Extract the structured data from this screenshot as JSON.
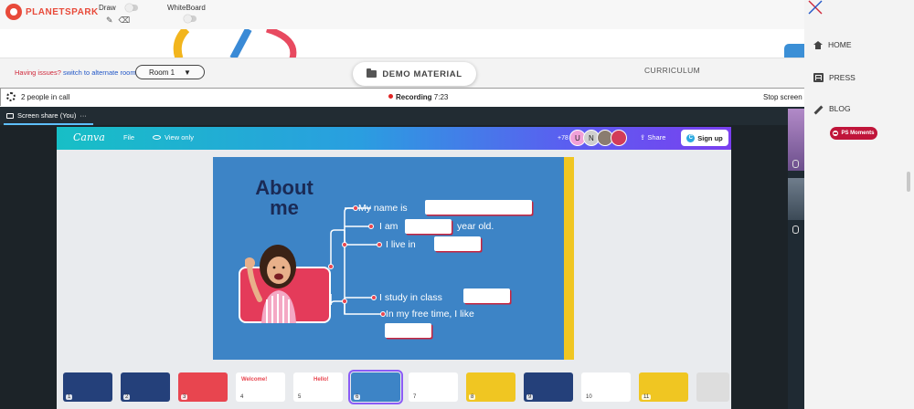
{
  "toolbar": {
    "logo_text": "PLANETSPARK",
    "draw_label": "Draw",
    "whiteboard_label": "WhiteBoard"
  },
  "roombar": {
    "issues_text": "Having issues?",
    "alternate_link": "switch to alternate room",
    "room_value": "Room 1",
    "room_caret": "▼",
    "demo_material": "DEMO MATERIAL",
    "curriculum": "CURRICULUM"
  },
  "callbar": {
    "people": "2 people in call",
    "recording_label": "Recording",
    "recording_time": "7:23",
    "stop_screen": "Stop screen"
  },
  "sharebar": {
    "label": "Screen share (You)",
    "more": "···"
  },
  "canva": {
    "logo": "Canva",
    "file": "File",
    "view_only": "View only",
    "collab_count": "+78",
    "avatar_u": "U",
    "avatar_n": "N",
    "share": "Share",
    "sign_up": "Sign up",
    "signup_glyph": "C"
  },
  "slide": {
    "title_line1": "About",
    "title_line2": "me",
    "my_name": "My name is",
    "i_am": "I am",
    "year_old": "year old.",
    "live_in": "I live in",
    "study_in": "I study in class",
    "free_time": "In my free time, I like"
  },
  "thumbnails": {
    "items": [
      {
        "num": "1",
        "word": "",
        "bg": "#24407a"
      },
      {
        "num": "2",
        "word": "",
        "bg": "#24407a"
      },
      {
        "num": "3",
        "word": "",
        "bg": "#e8454f"
      },
      {
        "num": "4",
        "word": "Welcome!",
        "bg": "#ffffff"
      },
      {
        "num": "5",
        "word": "Hello!",
        "bg": "#ffffff"
      },
      {
        "num": "6",
        "word": "",
        "bg": "#3d84c6"
      },
      {
        "num": "7",
        "word": "",
        "bg": "#ffffff"
      },
      {
        "num": "8",
        "word": "",
        "bg": "#f0c622"
      },
      {
        "num": "9",
        "word": "",
        "bg": "#24407a"
      },
      {
        "num": "10",
        "word": "",
        "bg": "#ffffff"
      },
      {
        "num": "11",
        "word": "",
        "bg": "#f0c622"
      },
      {
        "num": "",
        "word": "",
        "bg": "#dddddd"
      }
    ]
  },
  "sidebar": {
    "home": "HOME",
    "press": "PRESS",
    "blog": "BLOG",
    "ps_moments": "PS Moments"
  }
}
